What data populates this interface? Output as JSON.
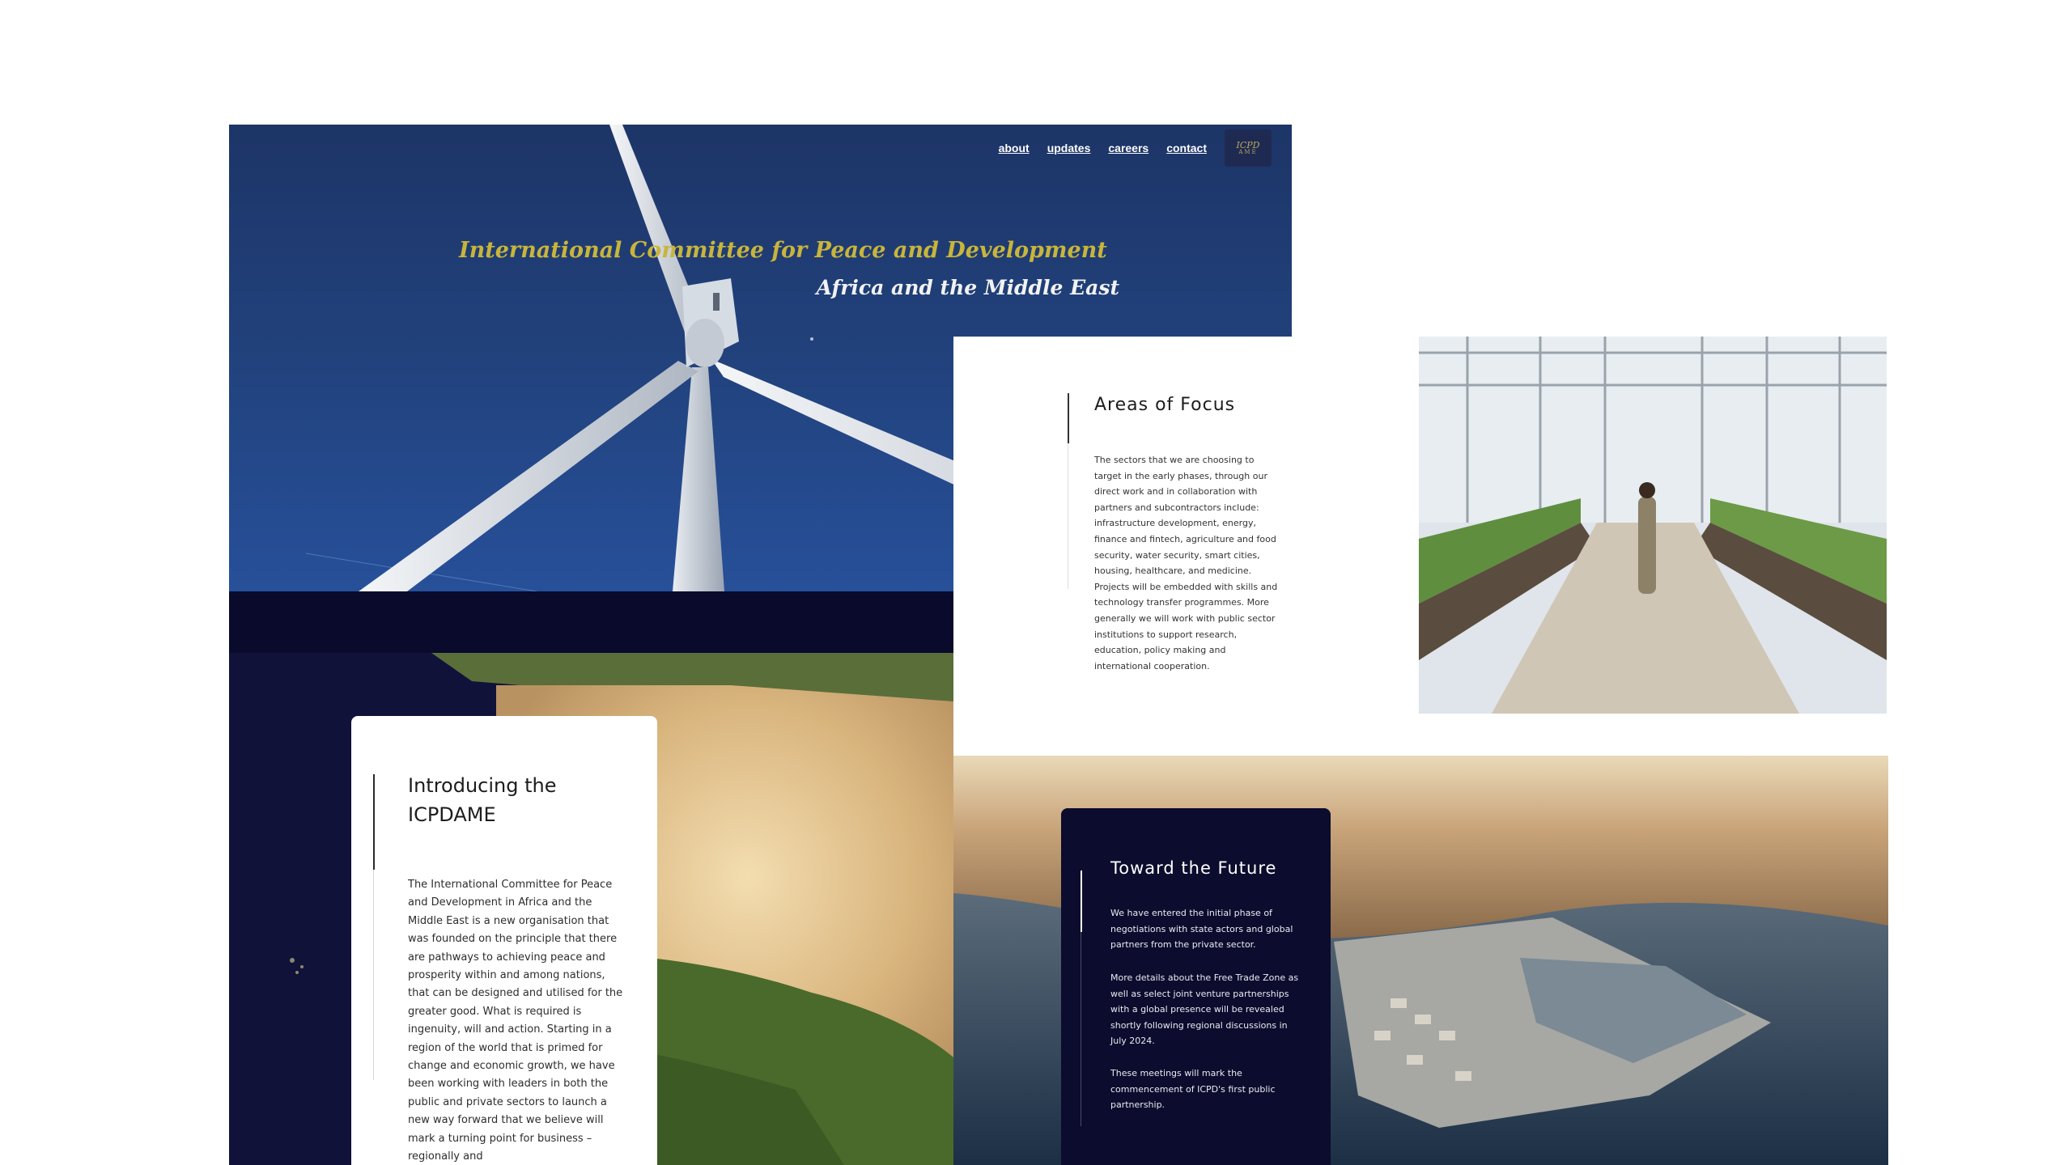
{
  "nav": {
    "links": [
      "about",
      "updates",
      "careers",
      "contact"
    ],
    "logo_text": "ICPD",
    "logo_subtext": "AME"
  },
  "hero": {
    "title": "International Committee for Peace and Development",
    "subtitle": "Africa and the Middle East"
  },
  "intro": {
    "heading": "Introducing the ICPDAME",
    "body": "The International Committee for Peace and Development in Africa and the Middle East is a new organisation that was founded on the principle that there are pathways to achieving peace and prosperity within and among nations, that can be designed and utilised for the greater good. What is required is ingenuity, will and action. Starting in a region of the world that is primed for change and economic growth, we have been working with leaders in both the public and private sectors to launch a new way forward that we believe will mark a turning point for business – regionally and"
  },
  "focus": {
    "heading": "Areas of Focus",
    "body": "The sectors that we are choosing to target in the early phases, through our direct work and in collaboration with partners and subcontractors include: infrastructure development, energy, finance and fintech, agriculture and food security, water security, smart cities, housing, healthcare, and medicine. Projects will be embedded with skills and technology transfer programmes. More generally we will work with public sector institutions to support research, education, policy making and international cooperation."
  },
  "future": {
    "heading": "Toward the Future",
    "p1": "We have entered the initial phase of negotiations with state actors and global partners from the private sector.",
    "p2": "More details about the Free Trade Zone as well as select joint venture partnerships with a global presence will be revealed shortly following regional discussions in July 2024.",
    "p3": "These meetings will mark the commencement of ICPD's first public partnership."
  },
  "colors": {
    "hero_sky": "#22437f",
    "title_gold": "#c8b53b",
    "dark_navy": "#0c0c2e"
  }
}
